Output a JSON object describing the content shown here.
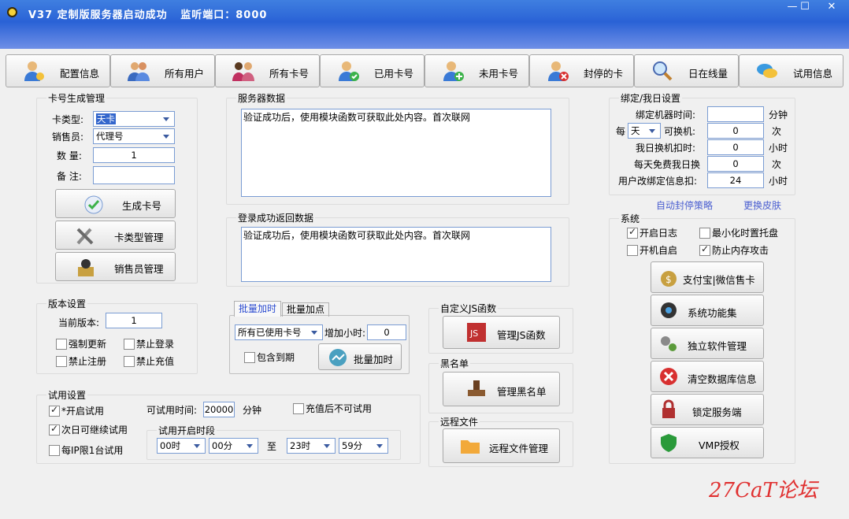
{
  "window": {
    "title": "V37 定制版服务器启动成功   监听端口：8000"
  },
  "toolbar": [
    {
      "label": "配置信息",
      "icon": "user-config-icon"
    },
    {
      "label": "所有用户",
      "icon": "users-icon"
    },
    {
      "label": "所有卡号",
      "icon": "people-icon"
    },
    {
      "label": "已用卡号",
      "icon": "user-check-icon"
    },
    {
      "label": "未用卡号",
      "icon": "user-add-icon"
    },
    {
      "label": "封停的卡",
      "icon": "user-block-icon"
    },
    {
      "label": "日在线量",
      "icon": "magnifier-icon"
    },
    {
      "label": "试用信息",
      "icon": "chat-icon"
    }
  ],
  "card_gen": {
    "title": "卡号生成管理",
    "type_label": "卡类型:",
    "type_value": "天卡",
    "seller_label": "销售员:",
    "seller_value": "代理号",
    "qty_label": "数  量:",
    "qty_value": "1",
    "note_label": "备  注:",
    "note_value": "",
    "gen_btn": "生成卡号",
    "type_mgr_btn": "卡类型管理",
    "seller_mgr_btn": "销售员管理"
  },
  "server": {
    "title": "服务器数据",
    "text": "验证成功后，使用模块函数可获取此处内容。首次联网"
  },
  "login": {
    "title": "登录成功返回数据",
    "text": "验证成功后，使用模块函数可获取此处内容。首次联网"
  },
  "bind": {
    "title": "绑定/我日设置",
    "bind_time_label": "绑定机器时间:",
    "bind_time_value": "",
    "bind_time_unit": "分钟",
    "per_label": "每",
    "per_value": "天",
    "change_label": "可换机:",
    "change_value": "0",
    "change_unit": "次",
    "deduct_label": "我日换机扣时:",
    "deduct_value": "0",
    "deduct_unit": "小时",
    "free_label": "每天免费我日换",
    "free_value": "0",
    "free_unit": "次",
    "user_change_label": "用户改绑定信息扣:",
    "user_change_value": "24",
    "user_change_unit": "小时"
  },
  "links": {
    "auto_ban": "自动封停策略",
    "skin": "更换皮肤"
  },
  "system": {
    "title": "系统",
    "log": "开启日志",
    "tray": "最小化时置托盘",
    "autostart": "开机自启",
    "memprotect": "防止内存攻击",
    "btns": [
      "支付宝|微信售卡",
      "系统功能集",
      "独立软件管理",
      "清空数据库信息",
      "锁定服务端",
      "VMP授权"
    ]
  },
  "version": {
    "title": "版本设置",
    "current_label": "当前版本:",
    "current_value": "1",
    "force": "强制更新",
    "no_login": "禁止登录",
    "no_reg": "禁止注册",
    "no_recharge": "禁止充值"
  },
  "batch": {
    "tab1": "批量加时",
    "tab2": "批量加点",
    "sel": "所有已使用卡号",
    "hours_label": "增加小时:",
    "hours_value": "0",
    "include": "包含到期",
    "btn": "批量加时"
  },
  "js": {
    "title": "自定义JS函数",
    "btn": "管理JS函数"
  },
  "blacklist": {
    "title": "黑名单",
    "btn": "管理黑名单"
  },
  "remote": {
    "title": "远程文件",
    "btn": "远程文件管理"
  },
  "trial": {
    "title": "试用设置",
    "enable": "*开启试用",
    "nextday": "次日可继续试用",
    "perip": "每IP限1台试用",
    "time_label": "可试用时间:",
    "time_value": "20000",
    "time_unit": "分钟",
    "recharge": "充值后不可试用",
    "period_title": "试用开启时段",
    "h1": "00时",
    "m1": "00分",
    "to": "至",
    "h2": "23时",
    "m2": "59分"
  },
  "watermark": "27CaT论坛"
}
